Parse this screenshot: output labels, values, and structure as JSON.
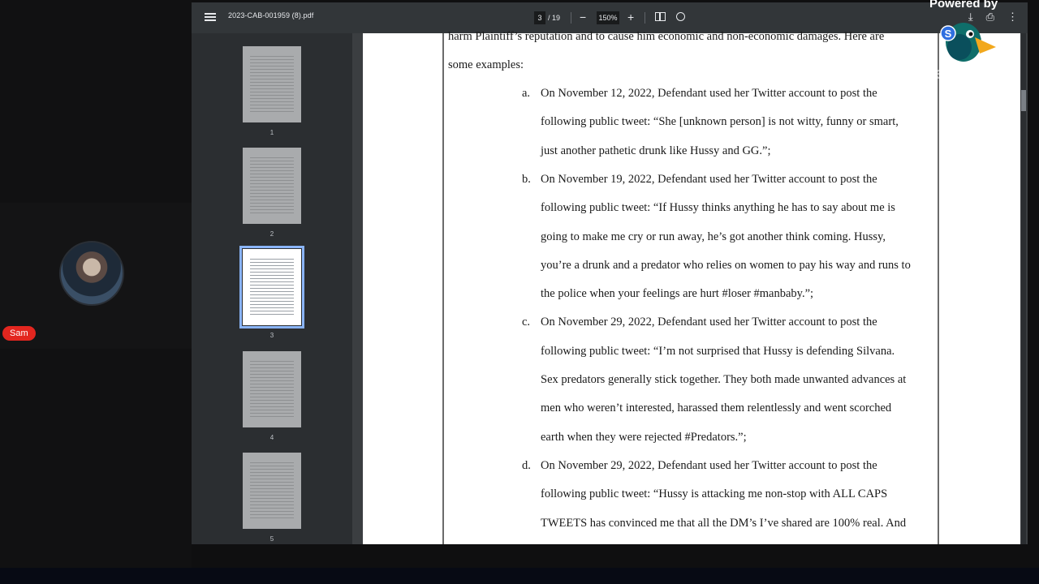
{
  "participant": {
    "name": "Sam"
  },
  "pdf_viewer": {
    "file_name": "2023-CAB-001959 (8).pdf",
    "current_page": "3",
    "page_total": "/ 19",
    "zoom": "150%",
    "zoom_out_glyph": "−",
    "zoom_in_glyph": "+",
    "thumbnails": [
      "1",
      "2",
      "3",
      "4",
      "5"
    ],
    "active_thumbnail": "3"
  },
  "document": {
    "lines": [
      "harm Plaintiff’s reputation and to cause him economic and non-economic damages.  Here are",
      "some examples:"
    ],
    "items": [
      {
        "letter": "a.",
        "lines": [
          "On November 12, 2022, Defendant used her Twitter account to post the",
          "following public tweet: “She [unknown person] is not witty, funny or smart,",
          "just another pathetic drunk like Hussy and GG.”;"
        ]
      },
      {
        "letter": "b.",
        "lines": [
          "On November 19, 2022, Defendant used her Twitter account to post the",
          "following public tweet: “If Hussy thinks anything he has to say about me is",
          "going to make me cry or run away, he’s got another think coming. Hussy,",
          "you’re a drunk and a predator who relies on women to pay his way and runs to",
          "the police when your feelings are hurt #loser #manbaby.”;"
        ]
      },
      {
        "letter": "c.",
        "lines": [
          "On November 29, 2022, Defendant used her Twitter account to post the",
          "following public tweet: “I’m not surprised that Hussy is defending Silvana.",
          "Sex predators generally stick together. They both made unwanted advances at",
          "men who weren’t interested, harassed them relentlessly and went scorched",
          "earth when they were rejected #Predators.”;"
        ]
      },
      {
        "letter": "d.",
        "lines": [
          "On November 29, 2022, Defendant used her Twitter account to post the",
          "following public tweet: “Hussy is attacking me non-stop with ALL CAPS",
          "TWEETS has convinced me that all the DM’s I’ve shared are 100% real. And"
        ]
      }
    ]
  },
  "overlay": {
    "powered_by": "Powered by",
    "brand": "StreamYard",
    "logo_letter": "S"
  }
}
